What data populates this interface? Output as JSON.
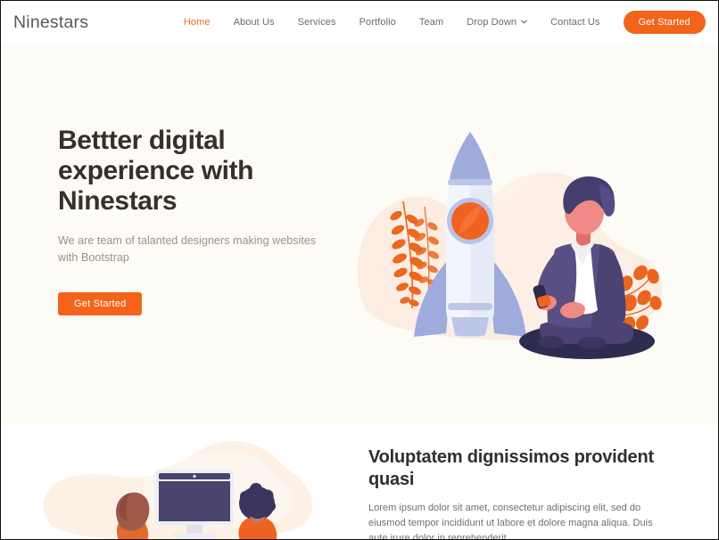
{
  "header": {
    "logo": "Ninestars",
    "nav": [
      {
        "label": "Home",
        "active": true,
        "dropdown": false
      },
      {
        "label": "About Us",
        "active": false,
        "dropdown": false
      },
      {
        "label": "Services",
        "active": false,
        "dropdown": false
      },
      {
        "label": "Portfolio",
        "active": false,
        "dropdown": false
      },
      {
        "label": "Team",
        "active": false,
        "dropdown": false
      },
      {
        "label": "Drop Down",
        "active": false,
        "dropdown": true
      },
      {
        "label": "Contact Us",
        "active": false,
        "dropdown": false
      }
    ],
    "cta_label": "Get Started"
  },
  "hero": {
    "title": "Bettter digital experience with Ninestars",
    "subtitle": "We are team of talanted designers making websites with Bootstrap",
    "cta_label": "Get Started",
    "illustration_name": "rocket-and-seated-person-illustration"
  },
  "section2": {
    "title": "Voluptatem dignissimos provident quasi",
    "text": "Lorem ipsum dolor sit amet, consectetur adipiscing elit, sed do eiusmod tempor incididunt ut labore et dolore magna aliqua. Duis aute irure dolor in reprehenderit",
    "illustration_name": "two-people-at-monitor-illustration"
  },
  "colors": {
    "accent": "#f4631a",
    "accent_light": "#ef6b27",
    "hero_background": "#fdfbf5",
    "page_background": "#ffffff",
    "heading": "#37302a",
    "muted_text": "#9a9287",
    "body_text": "#6f6f6f",
    "blob": "#fbeadc",
    "rocket_blue": "#a9b5e4",
    "rocket_body": "#f2f4fb",
    "person_purple": "#4c4374",
    "skin": "#f08a86"
  }
}
